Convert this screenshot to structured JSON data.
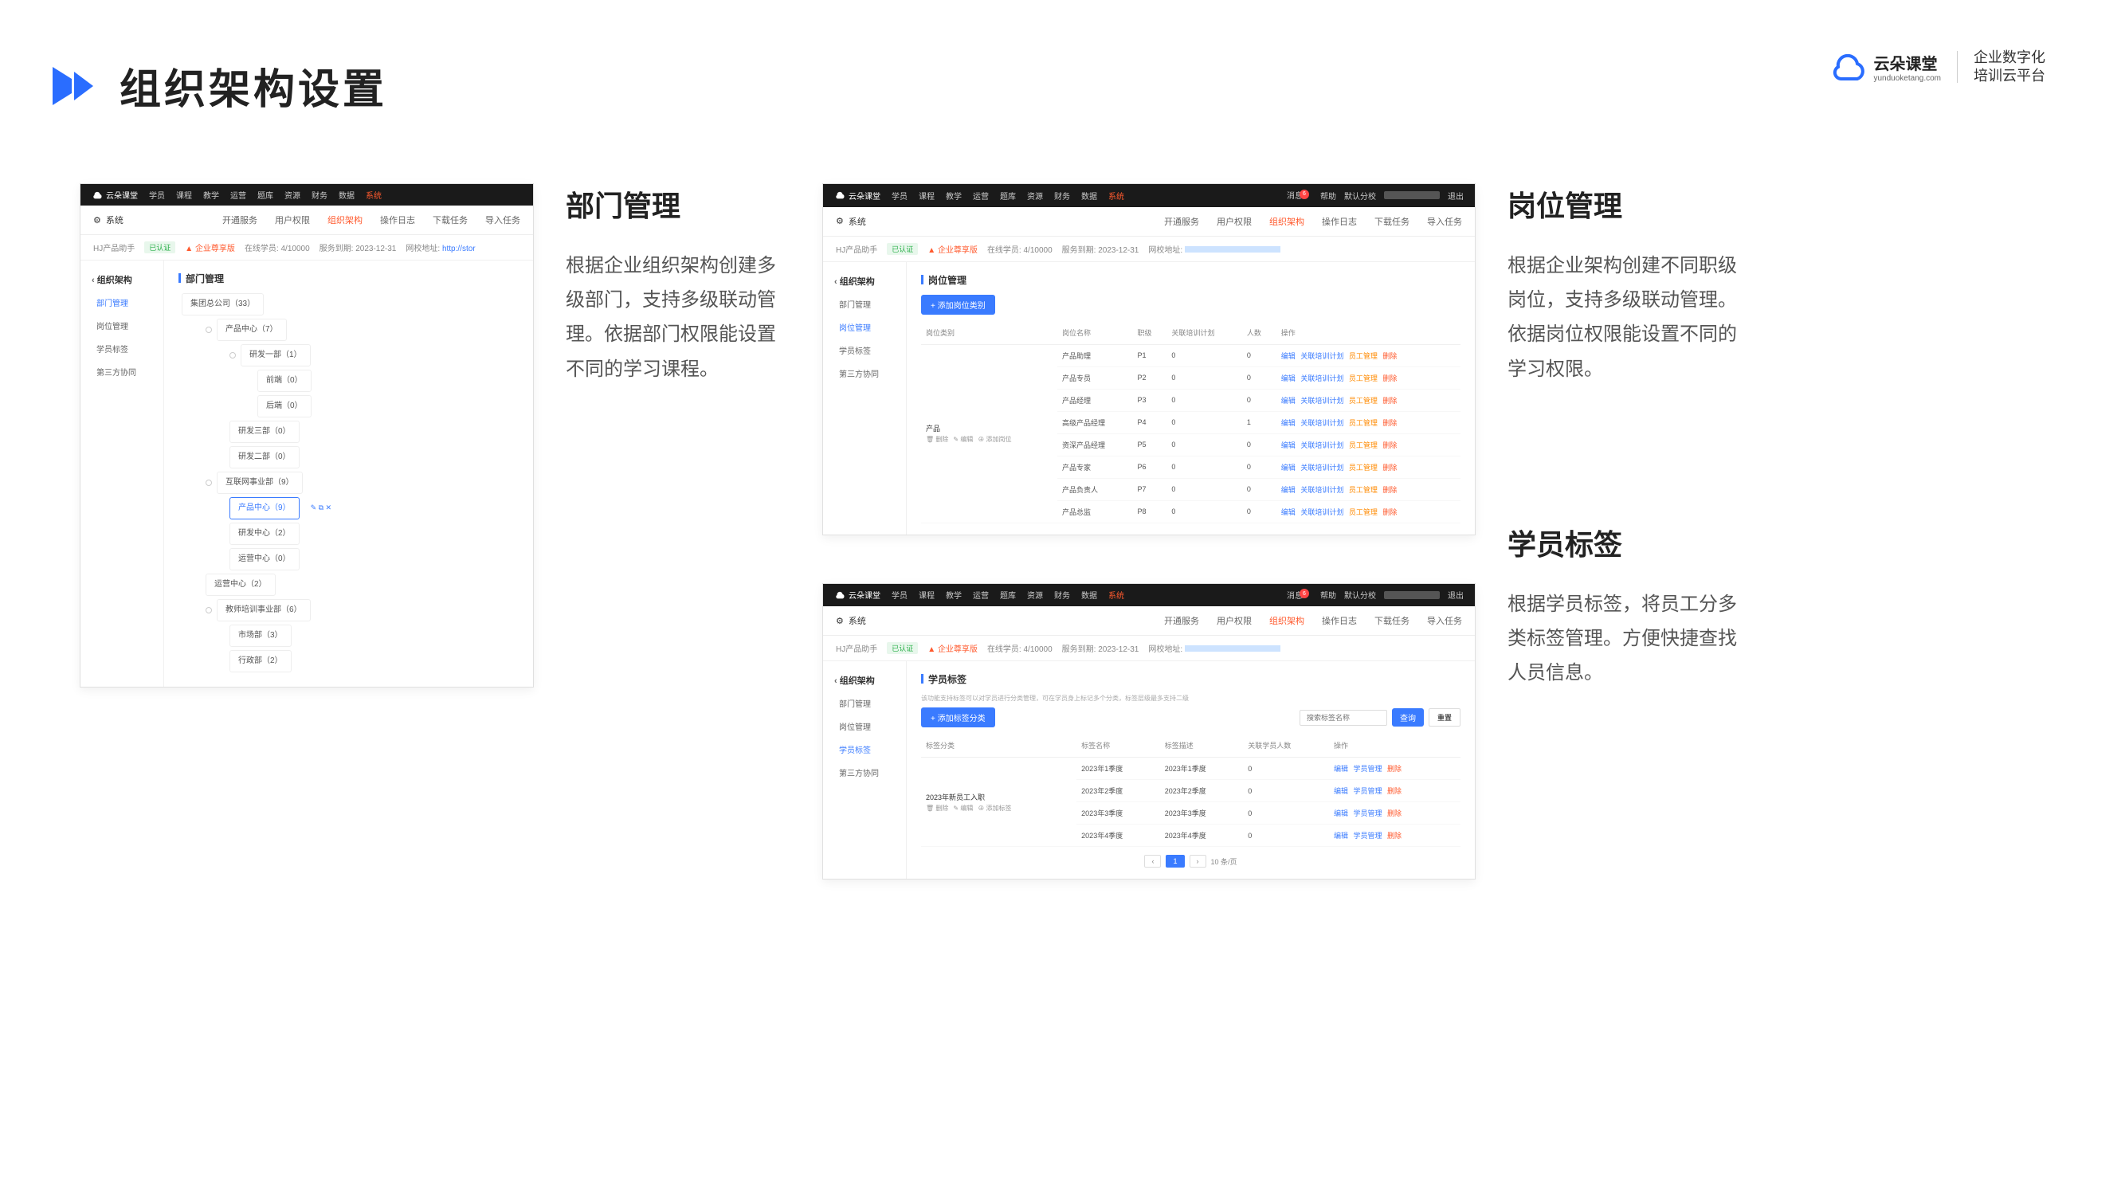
{
  "header": {
    "title": "组织架构设置"
  },
  "brand": {
    "name": "云朵课堂",
    "url": "yunduoketang.com",
    "tagline1": "企业数字化",
    "tagline2": "培训云平台"
  },
  "section1": {
    "title": "部门管理",
    "desc": "根据企业组织架构创建多级部门，支持多级联动管理。依据部门权限能设置不同的学习课程。"
  },
  "section2": {
    "title": "岗位管理",
    "desc": "根据企业架构创建不同职级岗位，支持多级联动管理。依据岗位权限能设置不同的学习权限。"
  },
  "section3": {
    "title": "学员标签",
    "desc": "根据学员标签，将员工分多类标签管理。方便快捷查找人员信息。"
  },
  "shot": {
    "topnav": [
      "学员",
      "课程",
      "教学",
      "运营",
      "题库",
      "资源",
      "财务",
      "数据",
      "系统"
    ],
    "topnav_active": "系统",
    "topr": {
      "msg": "消息",
      "help": "帮助",
      "branch": "默认分校",
      "exit": "退出"
    },
    "sub_sys": "系统",
    "sub_tabs": [
      "开通服务",
      "用户权限",
      "组织架构",
      "操作日志",
      "下载任务",
      "导入任务"
    ],
    "sub_active": "组织架构",
    "info": {
      "acct": "HJ产品助手",
      "verify": "已认证",
      "plan": "企业尊享版",
      "stu": "在线学员: 4/10000",
      "exp": "服务到期: 2023-12-31",
      "site_label": "网校地址:",
      "site": "http://stor"
    },
    "side_title": "组织架构",
    "side_items": [
      "部门管理",
      "岗位管理",
      "学员标签",
      "第三方协同"
    ]
  },
  "shot1": {
    "main_title": "部门管理",
    "tree": {
      "root": "集团总公司（33）",
      "n1": "产品中心（7）",
      "n11": "研发一部（1）",
      "n111": "前端（0）",
      "n112": "后端（0）",
      "n12": "研发三部（0）",
      "n13": "研发二部（0）",
      "n2": "互联网事业部（9）",
      "n21": "产品中心（9）",
      "n22": "研发中心（2）",
      "n23": "运营中心（0）",
      "n3": "运营中心（2）",
      "n4": "教师培训事业部（6）",
      "n41": "市场部（3）",
      "n42": "行政部（2）"
    }
  },
  "shot2": {
    "main_title": "岗位管理",
    "btn": "+ 添加岗位类别",
    "headers": [
      "岗位类别",
      "岗位名称",
      "职级",
      "关联培训计划",
      "人数",
      "操作"
    ],
    "cat": "产品",
    "catmeta_del": "删除",
    "catmeta_edit": "编辑",
    "catmeta_add": "添加岗位",
    "rows": [
      {
        "name": "产品助理",
        "level": "P1",
        "plan": "0",
        "num": "0"
      },
      {
        "name": "产品专员",
        "level": "P2",
        "plan": "0",
        "num": "0"
      },
      {
        "name": "产品经理",
        "level": "P3",
        "plan": "0",
        "num": "0"
      },
      {
        "name": "高级产品经理",
        "level": "P4",
        "plan": "0",
        "num": "1"
      },
      {
        "name": "资深产品经理",
        "level": "P5",
        "plan": "0",
        "num": "0"
      },
      {
        "name": "产品专家",
        "level": "P6",
        "plan": "0",
        "num": "0"
      },
      {
        "name": "产品负责人",
        "level": "P7",
        "plan": "0",
        "num": "0"
      },
      {
        "name": "产品总监",
        "level": "P8",
        "plan": "0",
        "num": "0"
      }
    ],
    "ops": {
      "edit": "编辑",
      "plan": "关联培训计划",
      "emp": "员工管理",
      "del": "删除"
    }
  },
  "shot3": {
    "main_title": "学员标签",
    "note": "该功能支持标签可以对学员进行分类管理，可在学员身上标记多个分类，标签层级最多支持二级",
    "btn": "+ 添加标签分类",
    "search_ph": "搜索标签名称",
    "search_btn": "查询",
    "reset_btn": "重置",
    "headers": [
      "标签分类",
      "标签名称",
      "标签描述",
      "关联学员人数",
      "操作"
    ],
    "cat": "2023年新员工入职",
    "catmeta_del": "删除",
    "catmeta_edit": "编辑",
    "catmeta_add": "添加标签",
    "rows": [
      {
        "name": "2023年1季度",
        "desc": "2023年1季度",
        "num": "0"
      },
      {
        "name": "2023年2季度",
        "desc": "2023年2季度",
        "num": "0"
      },
      {
        "name": "2023年3季度",
        "desc": "2023年3季度",
        "num": "0"
      },
      {
        "name": "2023年4季度",
        "desc": "2023年4季度",
        "num": "0"
      }
    ],
    "ops": {
      "edit": "编辑",
      "emp": "学员管理",
      "del": "删除"
    },
    "pager": {
      "prev": "‹",
      "p1": "1",
      "next": "›",
      "jump": "10 条/页"
    }
  }
}
